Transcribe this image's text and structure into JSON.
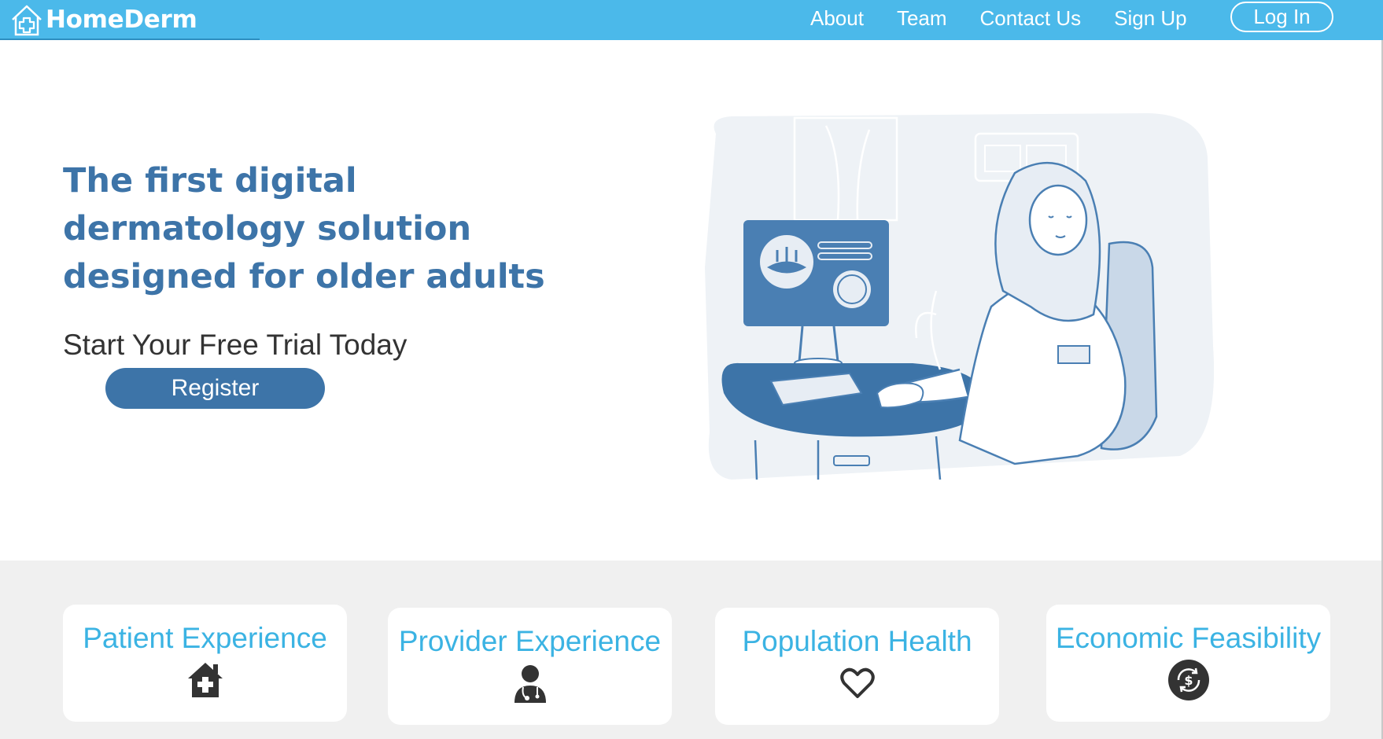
{
  "brand": {
    "name": "HomeDerm",
    "icon": "house-plus-logo-icon"
  },
  "nav": {
    "links": [
      "About",
      "Team",
      "Contact Us",
      "Sign Up"
    ],
    "login_label": "Log In"
  },
  "hero": {
    "title": "The first digital dermatology solution designed for older adults",
    "subtitle": "Start Your Free Trial Today",
    "register_label": "Register",
    "illustration": "doctor-at-computer-illustration"
  },
  "features": [
    {
      "title": "Patient Experience",
      "icon": "house-medical-icon"
    },
    {
      "title": "Provider Experience",
      "icon": "doctor-icon"
    },
    {
      "title": "Population Health",
      "icon": "heart-outline-icon"
    },
    {
      "title": "Economic Feasibility",
      "icon": "dollar-cycle-icon"
    }
  ],
  "colors": {
    "nav_bg": "#4bb9ea",
    "title_blue": "#3d74a8",
    "card_title": "#3bb3e3",
    "section_bg": "#f0f0f0"
  }
}
